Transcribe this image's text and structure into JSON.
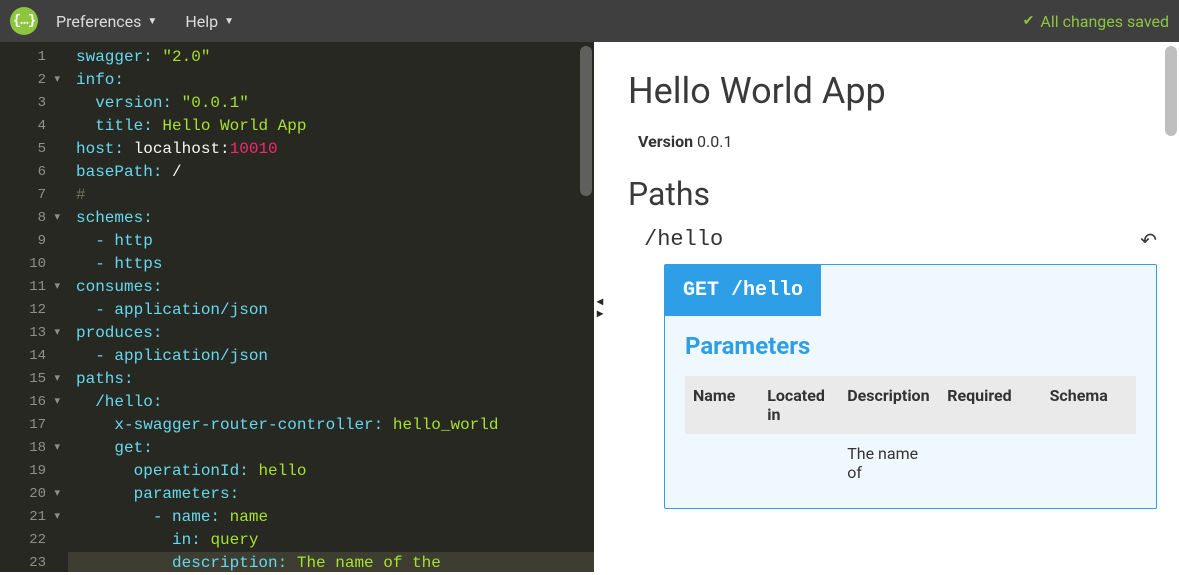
{
  "topbar": {
    "logo_text": "{…}",
    "menu": {
      "preferences": "Preferences",
      "help": "Help"
    },
    "status": "All changes saved"
  },
  "editor": {
    "lines": [
      {
        "n": 1,
        "fold": "",
        "segs": [
          {
            "t": "swagger:",
            "c": "k-key"
          },
          {
            "t": " ",
            "c": ""
          },
          {
            "t": "\"2.0\"",
            "c": "k-str"
          }
        ]
      },
      {
        "n": 2,
        "fold": "▾",
        "segs": [
          {
            "t": "info:",
            "c": "k-key"
          }
        ]
      },
      {
        "n": 3,
        "fold": "",
        "segs": [
          {
            "t": "  ",
            "c": ""
          },
          {
            "t": "version:",
            "c": "k-key"
          },
          {
            "t": " ",
            "c": ""
          },
          {
            "t": "\"0.0.1\"",
            "c": "k-str"
          }
        ]
      },
      {
        "n": 4,
        "fold": "",
        "segs": [
          {
            "t": "  ",
            "c": ""
          },
          {
            "t": "title:",
            "c": "k-key"
          },
          {
            "t": " ",
            "c": ""
          },
          {
            "t": "Hello World App",
            "c": "k-str"
          }
        ]
      },
      {
        "n": 5,
        "fold": "",
        "segs": [
          {
            "t": "host:",
            "c": "k-key"
          },
          {
            "t": " ",
            "c": ""
          },
          {
            "t": "localhost:",
            "c": "k-val"
          },
          {
            "t": "10010",
            "c": "k-num"
          }
        ]
      },
      {
        "n": 6,
        "fold": "",
        "segs": [
          {
            "t": "basePath:",
            "c": "k-key"
          },
          {
            "t": " ",
            "c": ""
          },
          {
            "t": "/",
            "c": "k-val"
          }
        ]
      },
      {
        "n": 7,
        "fold": "",
        "segs": [
          {
            "t": "# ",
            "c": "k-comment"
          }
        ]
      },
      {
        "n": 8,
        "fold": "▾",
        "segs": [
          {
            "t": "schemes:",
            "c": "k-key"
          }
        ]
      },
      {
        "n": 9,
        "fold": "",
        "segs": [
          {
            "t": "  ",
            "c": ""
          },
          {
            "t": "- http",
            "c": "k-key"
          }
        ]
      },
      {
        "n": 10,
        "fold": "",
        "segs": [
          {
            "t": "  ",
            "c": ""
          },
          {
            "t": "- https",
            "c": "k-key"
          }
        ]
      },
      {
        "n": 11,
        "fold": "▾",
        "segs": [
          {
            "t": "consumes:",
            "c": "k-key"
          }
        ]
      },
      {
        "n": 12,
        "fold": "",
        "segs": [
          {
            "t": "  ",
            "c": ""
          },
          {
            "t": "- application/json",
            "c": "k-key"
          }
        ]
      },
      {
        "n": 13,
        "fold": "▾",
        "segs": [
          {
            "t": "produces:",
            "c": "k-key"
          }
        ]
      },
      {
        "n": 14,
        "fold": "",
        "segs": [
          {
            "t": "  ",
            "c": ""
          },
          {
            "t": "- application/json",
            "c": "k-key"
          }
        ]
      },
      {
        "n": 15,
        "fold": "▾",
        "segs": [
          {
            "t": "paths:",
            "c": "k-key"
          }
        ]
      },
      {
        "n": 16,
        "fold": "▾",
        "segs": [
          {
            "t": "  ",
            "c": ""
          },
          {
            "t": "/hello:",
            "c": "k-key"
          }
        ]
      },
      {
        "n": 17,
        "fold": "",
        "segs": [
          {
            "t": "    ",
            "c": ""
          },
          {
            "t": "x-swagger-router-controller:",
            "c": "k-key"
          },
          {
            "t": " ",
            "c": ""
          },
          {
            "t": "hello_world",
            "c": "k-str"
          }
        ]
      },
      {
        "n": 18,
        "fold": "▾",
        "segs": [
          {
            "t": "    ",
            "c": ""
          },
          {
            "t": "get:",
            "c": "k-key"
          }
        ]
      },
      {
        "n": 19,
        "fold": "",
        "segs": [
          {
            "t": "      ",
            "c": ""
          },
          {
            "t": "operationId:",
            "c": "k-key"
          },
          {
            "t": " ",
            "c": ""
          },
          {
            "t": "hello",
            "c": "k-str"
          }
        ]
      },
      {
        "n": 20,
        "fold": "▾",
        "segs": [
          {
            "t": "      ",
            "c": ""
          },
          {
            "t": "parameters:",
            "c": "k-key"
          }
        ]
      },
      {
        "n": 21,
        "fold": "▾",
        "segs": [
          {
            "t": "        ",
            "c": ""
          },
          {
            "t": "- name:",
            "c": "k-key"
          },
          {
            "t": " ",
            "c": ""
          },
          {
            "t": "name",
            "c": "k-str"
          }
        ]
      },
      {
        "n": 22,
        "fold": "",
        "segs": [
          {
            "t": "          ",
            "c": ""
          },
          {
            "t": "in:",
            "c": "k-key"
          },
          {
            "t": " ",
            "c": ""
          },
          {
            "t": "query",
            "c": "k-str"
          }
        ]
      },
      {
        "n": 23,
        "fold": "",
        "active": true,
        "segs": [
          {
            "t": "          ",
            "c": ""
          },
          {
            "t": "description:",
            "c": "k-key"
          },
          {
            "t": " ",
            "c": ""
          },
          {
            "t": "The name of the",
            "c": "k-str"
          }
        ]
      }
    ]
  },
  "preview": {
    "title": "Hello World App",
    "version_label": "Version",
    "version_value": "0.0.1",
    "paths_heading": "Paths",
    "path": "/hello",
    "method_line": "GET /hello",
    "parameters_heading": "Parameters",
    "table": {
      "headers": [
        "Name",
        "Located in",
        "Description",
        "Required",
        "Schema"
      ],
      "rows": [
        {
          "name": "",
          "located_in": "",
          "description": "The name of",
          "required": "",
          "schema": ""
        }
      ]
    }
  }
}
